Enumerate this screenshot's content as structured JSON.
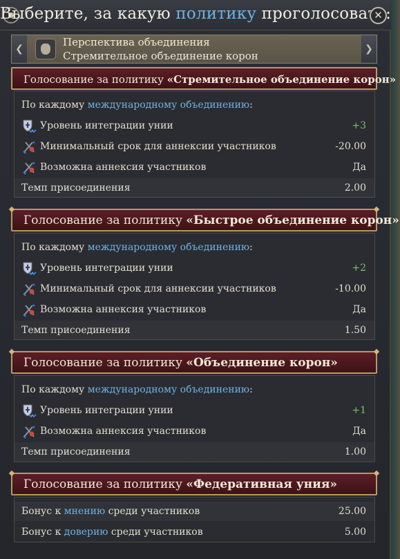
{
  "window": {
    "title_part1": "Выберите, за какую ",
    "title_link": "политику",
    "title_part2": " проголосовать:",
    "close_glyph": "✕"
  },
  "selector": {
    "title": "Перспектива объединения",
    "subtitle": "Стремительное объединение корон",
    "prev_glyph": "❮",
    "next_glyph": "❯"
  },
  "sections": [
    {
      "header_prefix": "Голосование за политику ",
      "header_name": "«Стремительное объединение корон»",
      "per_union_prefix": "По каждому ",
      "per_union_link": "международному объединению",
      "per_union_suffix": ":",
      "rows": [
        {
          "label": "Уровень интеграции унии",
          "value": "+3",
          "icon": "union-integration-icon"
        },
        {
          "label": "Минимальный срок для аннексии участников",
          "value": "-20.00",
          "icon": "annex-time-icon"
        },
        {
          "label": "Возможна аннексия участников",
          "value": "Да",
          "icon": "annex-icon"
        }
      ],
      "pace_label": "Темп присоединения",
      "pace_value": "2.00"
    },
    {
      "header_prefix": "Голосование за политику ",
      "header_name": "«Быстрое объединение корон»",
      "per_union_prefix": "По каждому ",
      "per_union_link": "международному объединению",
      "per_union_suffix": ":",
      "rows": [
        {
          "label": "Уровень интеграции унии",
          "value": "+2",
          "icon": "union-integration-icon"
        },
        {
          "label": "Минимальный срок для аннексии участников",
          "value": "-10.00",
          "icon": "annex-time-icon"
        },
        {
          "label": "Возможна аннексия участников",
          "value": "Да",
          "icon": "annex-icon"
        }
      ],
      "pace_label": "Темп присоединения",
      "pace_value": "1.50"
    },
    {
      "header_prefix": "Голосование за политику ",
      "header_name": "«Объединение корон»",
      "per_union_prefix": "По каждому ",
      "per_union_link": "международному объединению",
      "per_union_suffix": ":",
      "rows": [
        {
          "label": "Уровень интеграции унии",
          "value": "+1",
          "icon": "union-integration-icon"
        },
        {
          "label": "Возможна аннексия участников",
          "value": "Да",
          "icon": "annex-icon"
        }
      ],
      "pace_label": "Темп присоединения",
      "pace_value": "1.00"
    },
    {
      "header_prefix": "Голосование за политику ",
      "header_name": "«Федеративная уния»",
      "bonus_rows": [
        {
          "prefix": "Бонус к ",
          "link": "мнению",
          "suffix": " среди участников",
          "value": "25.00"
        },
        {
          "prefix": "Бонус к ",
          "link": "доверию",
          "suffix": " среди участников",
          "value": "5.00"
        }
      ]
    }
  ],
  "colors": {
    "accent_link": "#6fb3e6",
    "positive": "#77c46a",
    "header_bg": "#5c1e26",
    "header_border": "#b99a62"
  }
}
